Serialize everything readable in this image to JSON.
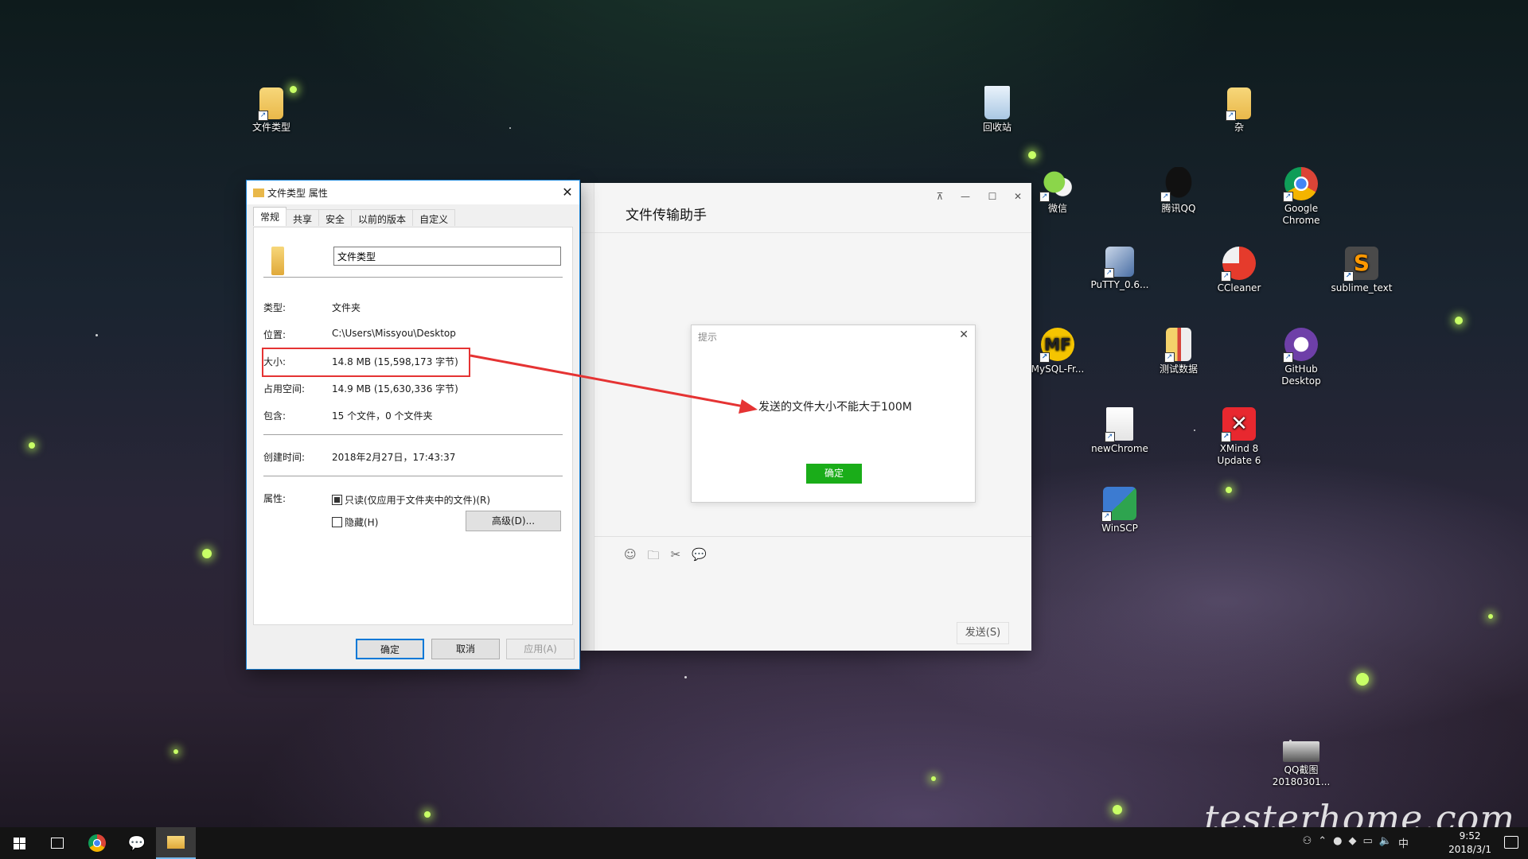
{
  "desktop": {
    "icons": [
      {
        "label": "文件类型"
      },
      {
        "label": "回收站"
      },
      {
        "label": "杂"
      },
      {
        "label": "微信"
      },
      {
        "label": "腾讯QQ"
      },
      {
        "label": "Google Chrome"
      },
      {
        "label": "PuTTY_0.6..."
      },
      {
        "label": "CCleaner"
      },
      {
        "label": "sublime_text"
      },
      {
        "label": "MySQL-Fr..."
      },
      {
        "label": "测试数据"
      },
      {
        "label": "GitHub Desktop"
      },
      {
        "label": "newChrome"
      },
      {
        "label": "XMind 8 Update 6"
      },
      {
        "label": "WinSCP"
      },
      {
        "label": "QQ截图 20180301..."
      }
    ]
  },
  "props": {
    "title": "文件类型 属性",
    "tabs": [
      "常规",
      "共享",
      "安全",
      "以前的版本",
      "自定义"
    ],
    "name_value": "文件类型",
    "rows": {
      "type": {
        "label": "类型:",
        "value": "文件夹"
      },
      "location": {
        "label": "位置:",
        "value": "C:\\Users\\Missyou\\Desktop"
      },
      "size": {
        "label": "大小:",
        "value": "14.8 MB (15,598,173 字节)"
      },
      "disk": {
        "label": "占用空间:",
        "value": "14.9 MB (15,630,336 字节)"
      },
      "contains": {
        "label": "包含:",
        "value": "15 个文件，0 个文件夹"
      },
      "created": {
        "label": "创建时间:",
        "value": "2018年2月27日，17:43:37"
      },
      "attrs": {
        "label": "属性:"
      }
    },
    "readonly_label": "只读(仅应用于文件夹中的文件)(R)",
    "hidden_label": "隐藏(H)",
    "advanced_label": "高级(D)...",
    "ok": "确定",
    "cancel": "取消",
    "apply": "应用(A)"
  },
  "chat": {
    "title": "文件传输助手",
    "modal_title": "提示",
    "modal_message": "发送的文件大小不能大于100M",
    "modal_ok": "确定",
    "send": "发送(S)"
  },
  "taskbar": {
    "time": "9:52",
    "date": "2018/3/1",
    "ime": "中"
  },
  "watermark": "testerhome.com"
}
